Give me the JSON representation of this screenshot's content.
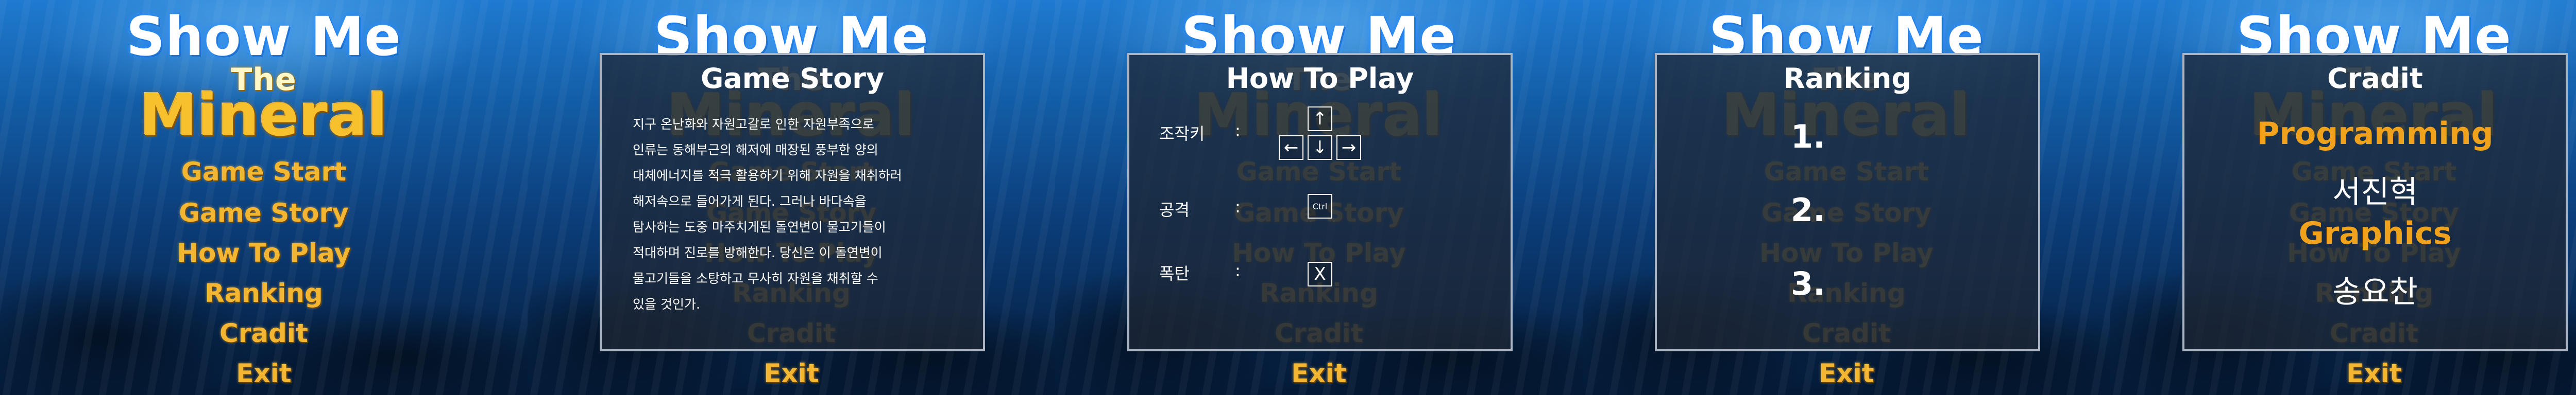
{
  "title": {
    "line1": "Show Me",
    "line2": "The",
    "line3": "Mineral"
  },
  "menu": [
    "Game Start",
    "Game Story",
    "How To Play",
    "Ranking",
    "Cradit",
    "Exit"
  ],
  "story_panel": {
    "title": "Game Story",
    "lines": [
      "지구 온난화와 자원고갈로 인한 자원부족으로",
      "인류는 동해부근의 해저에 매장된 풍부한 양의",
      "대체에너지를 적극 활용하기 위해 자원을 채취하러",
      "해저속으로 들어가게 된다. 그러나 바다속을",
      "탐사하는 도중 마주치게된 돌연변이 물고기들이",
      "적대하며 진로를 방해한다. 당신은 이 돌연변이",
      "물고기들을 소탕하고 무사히 자원을 채취할 수",
      "있을 것인가."
    ]
  },
  "howto_panel": {
    "title": "How To Play",
    "move_label": "조작키",
    "attack_label": "공격",
    "bomb_label": "폭탄",
    "colon": ":",
    "keys": {
      "up": "↑",
      "left": "←",
      "down": "↓",
      "right": "→",
      "attack": "Ctrl",
      "bomb": "X"
    }
  },
  "ranking_panel": {
    "title": "Ranking",
    "ranks": [
      "1.",
      "2.",
      "3."
    ]
  },
  "credit_panel": {
    "title": "Cradit",
    "entries": [
      {
        "role": "Programming",
        "name": "서진혁"
      },
      {
        "role": "Graphics",
        "name": "송요찬"
      }
    ]
  },
  "colors": {
    "menu_gold": "#f2b632",
    "credit_orange": "#f0a21c",
    "title_glow": "#288cff"
  }
}
